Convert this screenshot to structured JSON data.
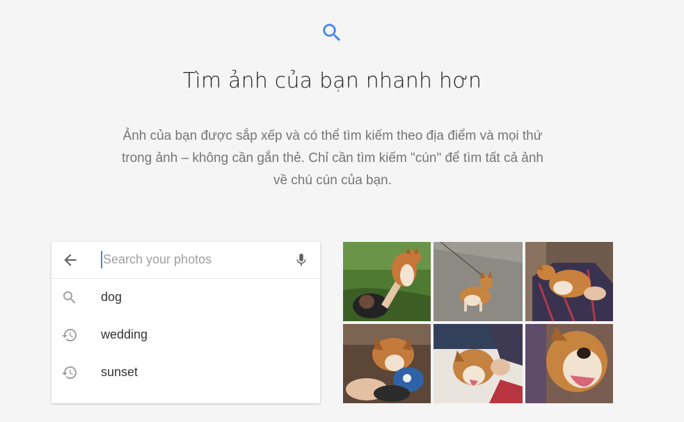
{
  "hero": {
    "title": "Tìm ảnh của bạn nhanh hơn",
    "description": "Ảnh của bạn được sắp xếp và có thể tìm kiếm theo địa điểm và mọi thứ trong ảnh – không cần gắn thẻ. Chỉ cần tìm kiếm \"cún\" để tìm tất cả ảnh về chú cún của bạn."
  },
  "search": {
    "placeholder": "Search your photos",
    "suggestions": [
      {
        "icon": "search-icon",
        "label": "dog"
      },
      {
        "icon": "history-icon",
        "label": "wedding"
      },
      {
        "icon": "history-icon",
        "label": "sunset"
      }
    ]
  },
  "colors": {
    "accent": "#4285f4",
    "background": "#f5f5f5",
    "icon_gray": "#757575"
  },
  "photos": [
    {
      "name": "photo-corgi-jumping-grass"
    },
    {
      "name": "photo-corgi-on-leash"
    },
    {
      "name": "photo-corgi-hugged"
    },
    {
      "name": "photo-corgi-toy"
    },
    {
      "name": "photo-corgi-tongue"
    },
    {
      "name": "photo-corgi-closeup"
    }
  ]
}
